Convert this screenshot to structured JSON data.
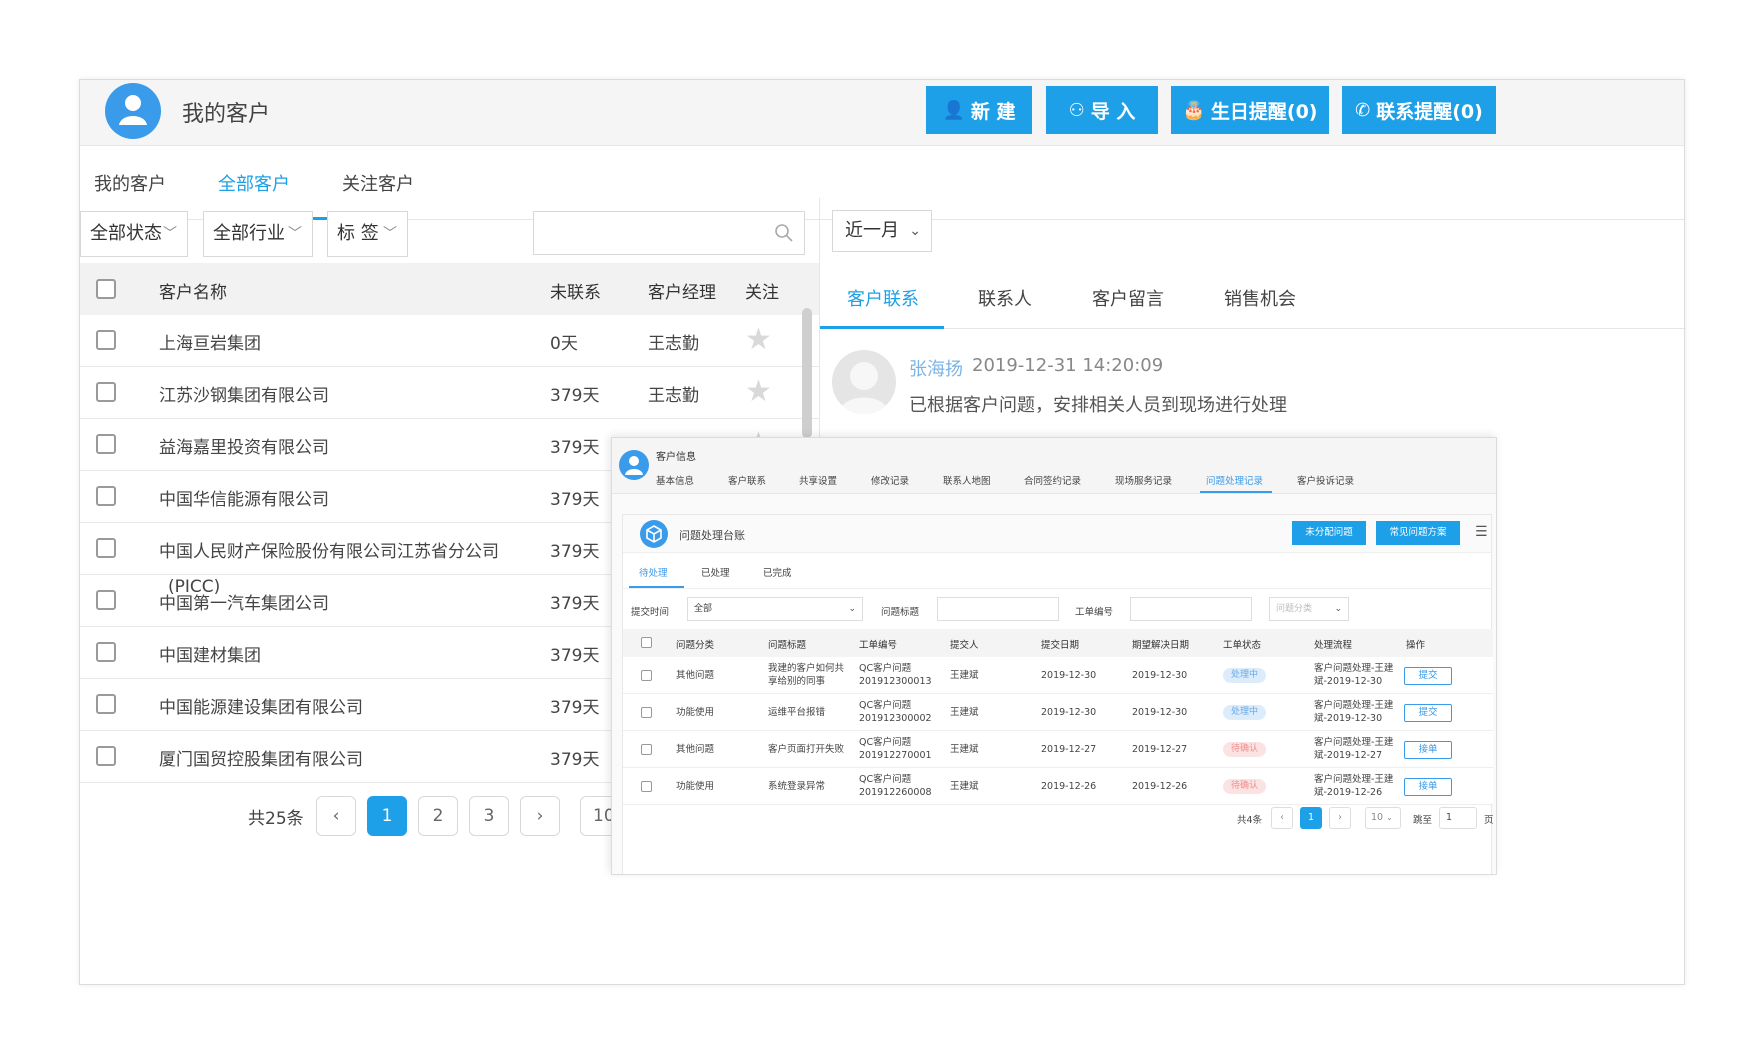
{
  "header": {
    "title": "我的客户",
    "buttons": [
      {
        "label": "新 建",
        "icon": "user-icon"
      },
      {
        "label": "导 入",
        "icon": "import-user-icon"
      },
      {
        "label": "生日提醒(0)",
        "icon": "cake-icon"
      },
      {
        "label": "联系提醒(0)",
        "icon": "phone-icon"
      }
    ],
    "accent_color": "#1ea0e8"
  },
  "main_tabs": [
    "我的客户",
    "全部客户",
    "关注客户"
  ],
  "active_main_tab": "全部客户",
  "filters": {
    "status": "全部状态",
    "industry": "全部行业",
    "tag": "标 签",
    "search_placeholder": ""
  },
  "customer_table": {
    "columns": [
      "客户名称",
      "未联系",
      "客户经理",
      "关注"
    ],
    "rows": [
      {
        "name": "上海亘岩集团",
        "days": "0天",
        "manager": "王志勤"
      },
      {
        "name": "江苏沙钢集团有限公司",
        "days": "379天",
        "manager": "王志勤"
      },
      {
        "name": "益海嘉里投资有限公司",
        "days": "379天",
        "manager": "王志勤"
      },
      {
        "name": "中国华信能源有限公司",
        "days": "379天",
        "manager": ""
      },
      {
        "name": "中国人民财产保险股份有限公司江苏省分公司",
        "days": "379天",
        "manager": ""
      },
      {
        "name": "中国第一汽车集团公司",
        "days": "379天",
        "manager": "",
        "overlap": "(PICC)"
      },
      {
        "name": "中国建材集团",
        "days": "379天",
        "manager": ""
      },
      {
        "name": "中国能源建设集团有限公司",
        "days": "379天",
        "manager": ""
      },
      {
        "name": "厦门国贸控股集团有限公司",
        "days": "379天",
        "manager": ""
      }
    ]
  },
  "pagination": {
    "total": "共25条",
    "prev": "‹",
    "pages": [
      "1",
      "2",
      "3"
    ],
    "next": "›",
    "page_size": "10",
    "current": "1"
  },
  "right_panel": {
    "period": "近一月",
    "tabs": [
      "客户联系",
      "联系人",
      "客户留言",
      "销售机会"
    ],
    "active_tab": "客户联系",
    "comment": {
      "author": "张海扬",
      "time": "2019-12-31 14:20:09",
      "text": "已根据客户问题，安排相关人员到现场进行处理"
    }
  },
  "overlay": {
    "title": "客户信息",
    "tabs": [
      "基本信息",
      "客户联系",
      "共享设置",
      "修改记录",
      "联系人地图",
      "合同签约记录",
      "现场服务记录",
      "问题处理记录",
      "客户投诉记录"
    ],
    "active_tab": "问题处理记录",
    "panel_title": "问题处理台账",
    "buttons": [
      "未分配问题",
      "常见问题方案"
    ],
    "status_tabs": [
      "待处理",
      "已处理",
      "已完成"
    ],
    "filters": {
      "submit_time_label": "提交时间",
      "submit_time_value": "全部",
      "issue_title_label": "问题标题",
      "order_no_label": "工单编号",
      "category_placeholder": "问题分类"
    },
    "columns": [
      "问题分类",
      "问题标题",
      "工单编号",
      "提交人",
      "提交日期",
      "期望解决日期",
      "工单状态",
      "处理流程",
      "操作"
    ],
    "rows": [
      {
        "category": "其他问题",
        "title": [
          "我建的客户如何共",
          "享给别的同事"
        ],
        "order": [
          "QC客户问题",
          "201912300013"
        ],
        "submitter": "王建斌",
        "submit_date": "2019-12-30",
        "expect_date": "2019-12-30",
        "status": "处理中",
        "status_color": "blue",
        "flow": [
          "客户问题处理-王建",
          "斌-2019-12-30"
        ],
        "action": "提交"
      },
      {
        "category": "功能使用",
        "title": [
          "运维平台报错"
        ],
        "order": [
          "QC客户问题",
          "201912300002"
        ],
        "submitter": "王建斌",
        "submit_date": "2019-12-30",
        "expect_date": "2019-12-30",
        "status": "处理中",
        "status_color": "blue",
        "flow": [
          "客户问题处理-王建",
          "斌-2019-12-30"
        ],
        "action": "提交"
      },
      {
        "category": "其他问题",
        "title": [
          "客户页面打开失败"
        ],
        "order": [
          "QC客户问题",
          "201912270001"
        ],
        "submitter": "王建斌",
        "submit_date": "2019-12-27",
        "expect_date": "2019-12-27",
        "status": "待确认",
        "status_color": "red",
        "flow": [
          "客户问题处理-王建",
          "斌-2019-12-27"
        ],
        "action": "接单"
      },
      {
        "category": "功能使用",
        "title": [
          "系统登录异常"
        ],
        "order": [
          "QC客户问题",
          "201912260008"
        ],
        "submitter": "王建斌",
        "submit_date": "2019-12-26",
        "expect_date": "2019-12-26",
        "status": "待确认",
        "status_color": "red",
        "flow": [
          "客户问题处理-王建",
          "斌-2019-12-26"
        ],
        "action": "接单"
      }
    ],
    "pagination": {
      "total": "共4条",
      "prev": "‹",
      "page": "1",
      "next": "›",
      "page_size": "10 ",
      "goto_label": "跳至",
      "goto_value": "1",
      "goto_suffix": "页"
    }
  }
}
